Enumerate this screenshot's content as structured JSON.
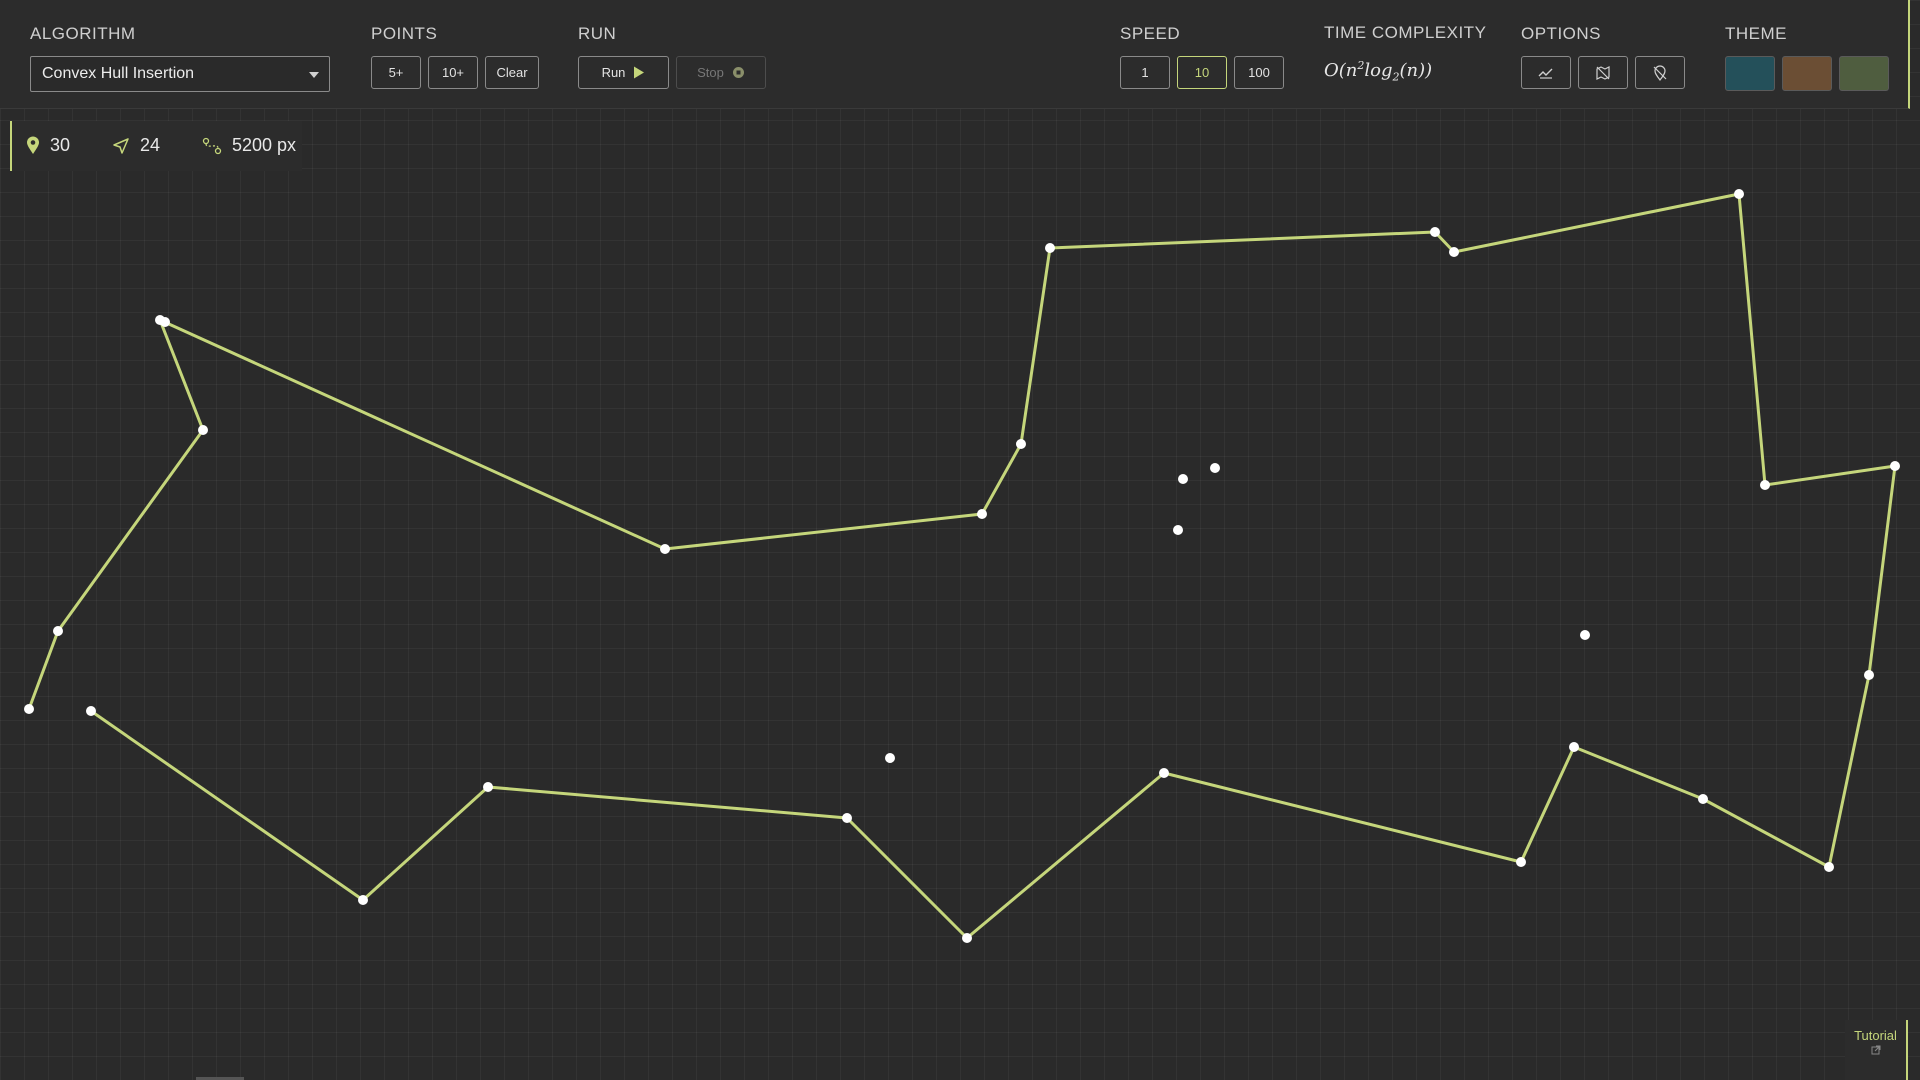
{
  "toolbar": {
    "algorithm": {
      "label": "ALGORITHM",
      "selected": "Convex Hull Insertion"
    },
    "points": {
      "label": "POINTS",
      "buttons": [
        "5+",
        "10+",
        "Clear"
      ]
    },
    "run": {
      "label": "RUN",
      "run_label": "Run",
      "stop_label": "Stop"
    },
    "speed": {
      "label": "SPEED",
      "options": [
        "1",
        "10",
        "100"
      ],
      "selected": "10"
    },
    "complexity": {
      "label": "TIME COMPLEXITY"
    },
    "options": {
      "label": "OPTIONS",
      "icons": [
        "chart-line-icon",
        "map-off-icon",
        "location-off-icon"
      ]
    },
    "theme": {
      "label": "THEME",
      "swatches": [
        "#24505a",
        "#6b4e34",
        "#4f5d3f"
      ]
    }
  },
  "stats": {
    "points_count": "30",
    "route_count": "24",
    "distance": "5200 px"
  },
  "tutorial": {
    "label": "Tutorial"
  },
  "colors": {
    "accent": "#c5d67b",
    "point": "#ffffff",
    "background": "#2a2a2a"
  }
}
